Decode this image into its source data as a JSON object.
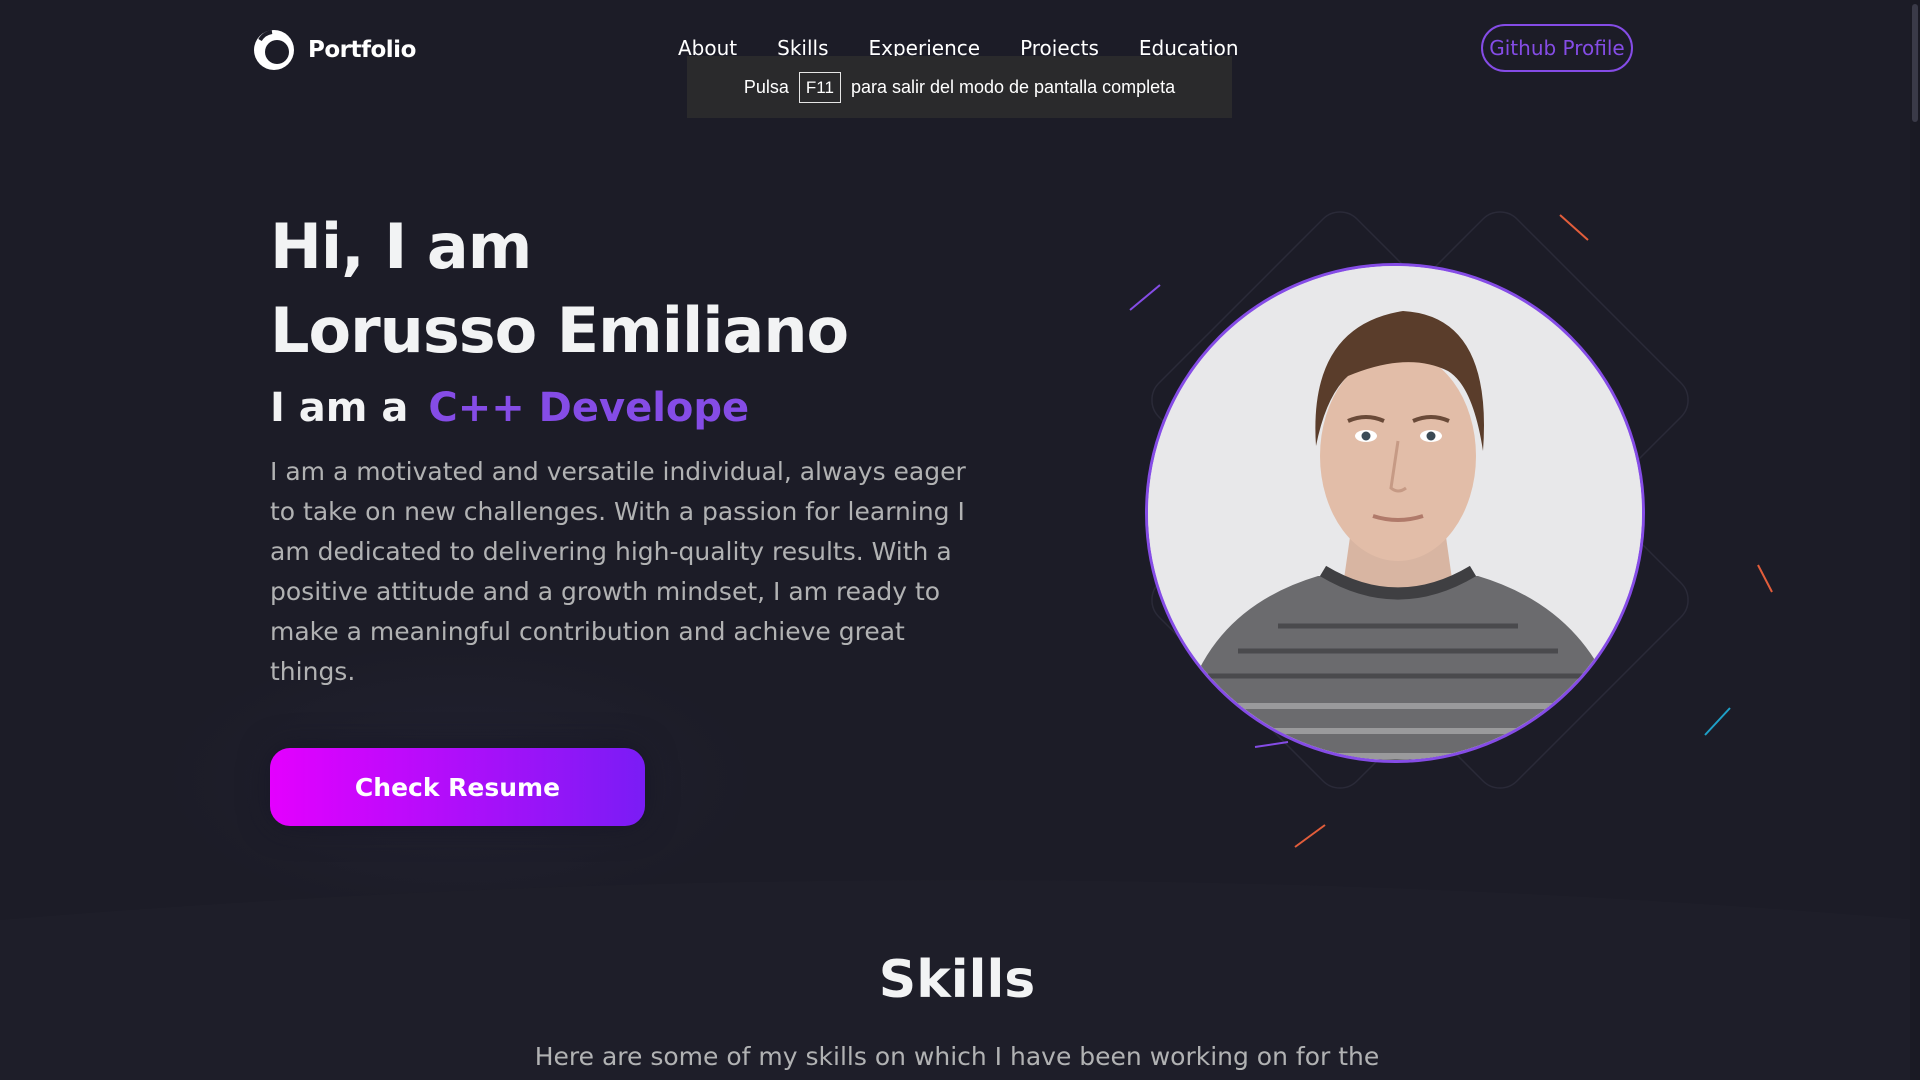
{
  "nav": {
    "logo_text": "Portfolio",
    "links": [
      "About",
      "Skills",
      "Experience",
      "Projects",
      "Education"
    ],
    "github_button": "Github Profile"
  },
  "fullscreen_toast": {
    "before": "Pulsa",
    "key": "F11",
    "after": "para salir del modo de pantalla completa"
  },
  "hero": {
    "greeting_line1": "Hi, I am",
    "greeting_line2": "Lorusso Emiliano",
    "role_prefix": "I am a",
    "role_typed": "C++ Develope",
    "description": "I am a motivated and versatile individual, always eager to take on new challenges. With a passion for learning I am dedicated to delivering high-quality results. With a positive attitude and a growth mindset, I am ready to make a meaningful contribution and achieve great things.",
    "resume_button": "Check Resume"
  },
  "skills": {
    "title": "Skills",
    "subtitle": "Here are some of my skills on which I have been working on for the"
  },
  "colors": {
    "background": "#1c1c27",
    "accent": "#854ce6",
    "text_primary": "#f2f3f4",
    "text_secondary": "#b1b2b3",
    "button_gradient_start": "#e400ff",
    "button_gradient_end": "#7a1cf5"
  },
  "icons": [
    "logo-icon",
    "profile-photo"
  ]
}
